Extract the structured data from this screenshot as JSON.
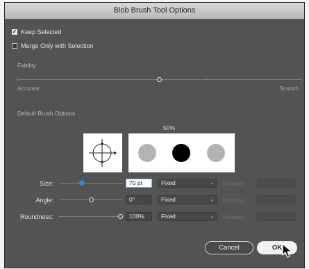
{
  "dialog": {
    "title": "Blob Brush Tool Options",
    "keep_selected": {
      "label": "Keep Selected",
      "checked": true
    },
    "merge_only": {
      "label": "Merge Only with Selection",
      "checked": false
    },
    "fidelity": {
      "label": "Fidelity",
      "min_label": "Accurate",
      "max_label": "Smooth",
      "value_fraction": 0.5
    },
    "brush_options": {
      "label": "Default Brush Options",
      "preview_percent": "50%"
    },
    "size": {
      "label": "Size:",
      "value": "70 pt",
      "mode": "Fixed",
      "variation_label": "Variation:",
      "slider_fraction": 0.35
    },
    "angle": {
      "label": "Angle:",
      "value": "0°",
      "mode": "Fixed",
      "variation_label": "Variation:",
      "slider_fraction": 0.5
    },
    "roundness": {
      "label": "Roundness:",
      "value": "100%",
      "mode": "Fixed",
      "variation_label": "Variation:",
      "slider_fraction": 1.0
    },
    "buttons": {
      "cancel": "Cancel",
      "ok": "OK"
    },
    "colors": {
      "panel": "#535353",
      "slider_accent": "#2f86d6",
      "brush_fill": "#000000",
      "brush_preview_gray": "#b3b3b3"
    },
    "icons": {
      "angle_indicator": "crosshair-circle-icon",
      "cursor": "mouse-pointer-icon"
    }
  }
}
